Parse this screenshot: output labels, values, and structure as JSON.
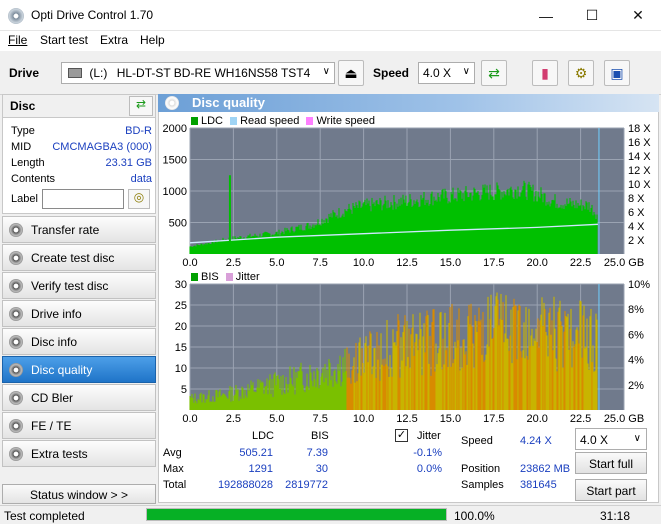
{
  "window": {
    "title": "Opti Drive Control 1.70"
  },
  "menu": [
    "File",
    "Start test",
    "Extra",
    "Help"
  ],
  "toolbar": {
    "drive_label": "Drive",
    "drive_letter": "(L:)",
    "drive_value": "HL-DT-ST BD-RE  WH16NS58 TST4",
    "speed_label": "Speed",
    "speed_value": "4.0 X"
  },
  "disc": {
    "header": "Disc",
    "rows": [
      {
        "label": "Type",
        "value": "BD-R"
      },
      {
        "label": "MID",
        "value": "CMCMAGBA3 (000)"
      },
      {
        "label": "Length",
        "value": "23.31 GB"
      },
      {
        "label": "Contents",
        "value": "data"
      }
    ],
    "label_field": "Label",
    "label_value": ""
  },
  "nav": [
    "Transfer rate",
    "Create test disc",
    "Verify test disc",
    "Drive info",
    "Disc info",
    "Disc quality",
    "CD Bler",
    "FE / TE",
    "Extra tests"
  ],
  "nav_active": "Disc quality",
  "status_window": "Status window > >",
  "panel_title": "Disc quality",
  "legend_top": [
    "LDC",
    "Read speed",
    "Write speed"
  ],
  "legend_bottom": [
    "BIS",
    "Jitter"
  ],
  "colors": {
    "ldc": "#00c000",
    "read": "#9fd4f5",
    "write": "#ff80ff",
    "bis": "#c8b000",
    "jitter": "#d9a0d9",
    "plot_bg": "#707a8c"
  },
  "chart_data": [
    {
      "type": "area",
      "title": "",
      "xlabel": "",
      "ylabel": "",
      "x_ticks": [
        "0.0",
        "2.5",
        "5.0",
        "7.5",
        "10.0",
        "12.5",
        "15.0",
        "17.5",
        "20.0",
        "22.5",
        "25.0 GB"
      ],
      "y_ticks": [
        "2000",
        "1500",
        "1000",
        "500"
      ],
      "y2_ticks": [
        "18 X",
        "16 X",
        "14 X",
        "12 X",
        "10 X",
        "8 X",
        "6 X",
        "4 X",
        "2 X"
      ],
      "xlim": [
        0,
        25
      ],
      "ylim": [
        0,
        2000
      ],
      "y2lim": [
        0,
        18
      ],
      "series": [
        {
          "name": "LDC",
          "x": [
            0,
            1,
            2,
            3,
            4,
            5,
            6,
            7,
            8,
            9,
            10,
            11,
            12,
            13,
            14,
            15,
            16,
            17,
            18,
            19,
            20,
            21,
            22,
            23,
            23.5
          ],
          "values": [
            120,
            170,
            230,
            270,
            300,
            330,
            400,
            460,
            590,
            700,
            760,
            800,
            830,
            860,
            900,
            920,
            950,
            980,
            1000,
            1040,
            960,
            840,
            790,
            770,
            620
          ]
        },
        {
          "name": "Read speed",
          "x": [
            0,
            5,
            10,
            15,
            20,
            23.5
          ],
          "values": [
            1.6,
            2.4,
            2.9,
            3.4,
            3.8,
            4.24
          ]
        }
      ]
    },
    {
      "type": "bar",
      "title": "",
      "xlabel": "",
      "ylabel": "",
      "x_ticks": [
        "0.0",
        "2.5",
        "5.0",
        "7.5",
        "10.0",
        "12.5",
        "15.0",
        "17.5",
        "20.0",
        "22.5",
        "25.0 GB"
      ],
      "y_ticks": [
        "30",
        "25",
        "20",
        "15",
        "10",
        "5"
      ],
      "y2_ticks": [
        "10%",
        "8%",
        "6%",
        "4%",
        "2%"
      ],
      "xlim": [
        0,
        25
      ],
      "ylim": [
        0,
        30
      ],
      "y2lim": [
        0,
        10
      ],
      "series": [
        {
          "name": "BIS",
          "x": [
            0,
            2,
            4,
            6,
            8,
            10,
            12,
            14,
            16,
            18,
            20,
            22,
            23.5
          ],
          "values": [
            3,
            4,
            6,
            8,
            11,
            14,
            17,
            18,
            20,
            21,
            21,
            20,
            18
          ]
        },
        {
          "name": "Jitter",
          "x": [
            0,
            23.5
          ],
          "values": [
            -0.1,
            -0.1
          ]
        }
      ]
    }
  ],
  "stats": {
    "headers": [
      "LDC",
      "BIS"
    ],
    "rows": [
      {
        "label": "Avg",
        "ldc": "505.21",
        "bis": "7.39",
        "jitter": "-0.1%"
      },
      {
        "label": "Max",
        "ldc": "1291",
        "bis": "30",
        "jitter": "0.0%"
      },
      {
        "label": "Total",
        "ldc": "192888028",
        "bis": "2819772",
        "jitter": ""
      }
    ],
    "jitter_label": "Jitter",
    "jitter_checked": true,
    "speed_label": "Speed",
    "speed_value": "4.24 X",
    "position_label": "Position",
    "position_value": "23862 MB",
    "samples_label": "Samples",
    "samples_value": "381645",
    "speed_select": "4.0 X",
    "start_full": "Start full",
    "start_part": "Start part"
  },
  "statusbar": {
    "text": "Test completed",
    "progress_pct": 100,
    "progress_text": "100.0%",
    "time": "31:18"
  }
}
